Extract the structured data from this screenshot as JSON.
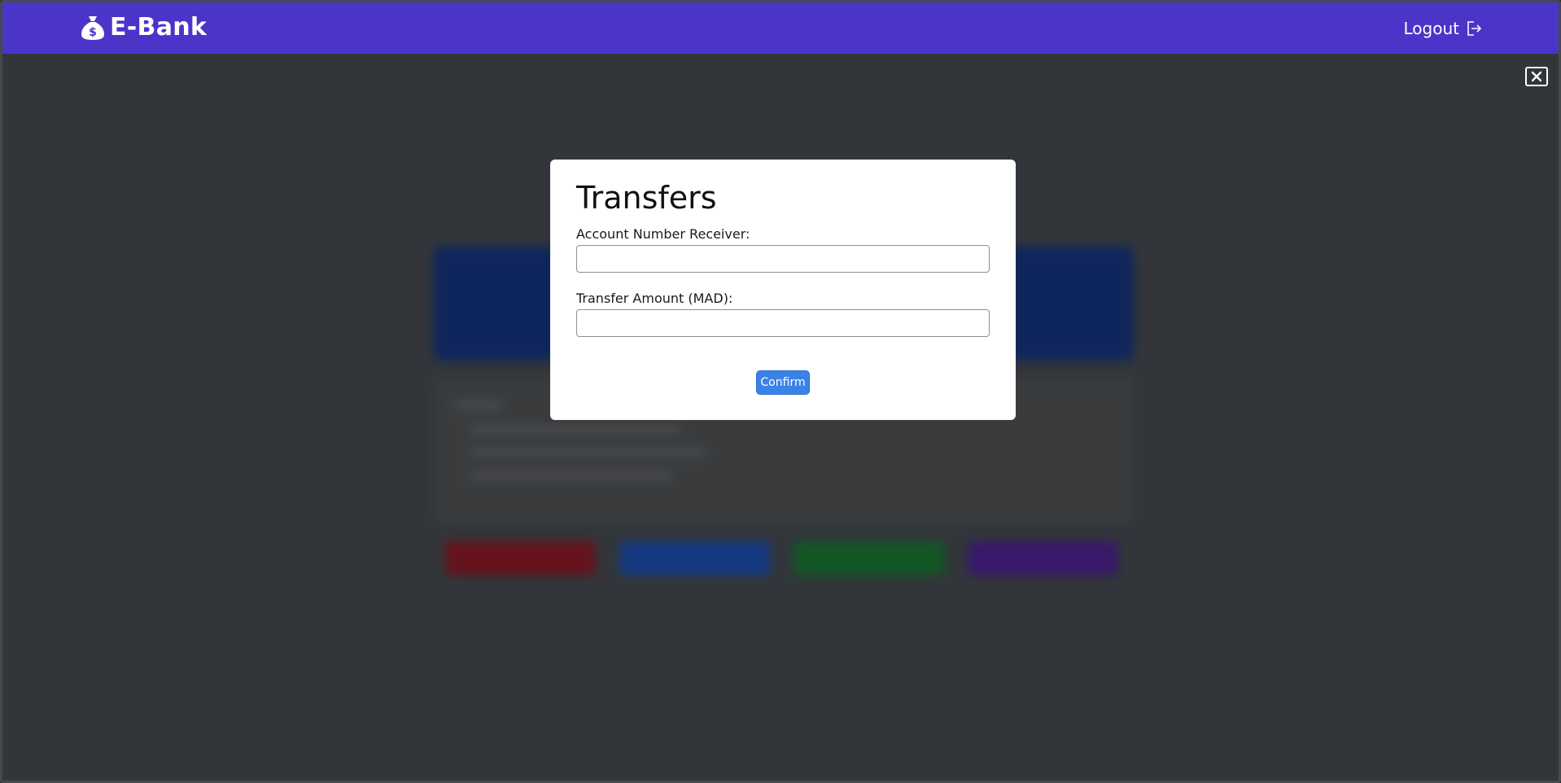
{
  "header": {
    "brand_name": "E-Bank",
    "brand_icon": "money-bag-icon",
    "logout_label": "Logout",
    "logout_icon": "logout-icon",
    "background_color": "#4b35c8"
  },
  "overlay": {
    "close_icon": "close-icon"
  },
  "modal": {
    "title": "Transfers",
    "fields": [
      {
        "label": "Account Number Receiver:",
        "value": "",
        "placeholder": ""
      },
      {
        "label": "Transfer Amount (MAD):",
        "value": "",
        "placeholder": ""
      }
    ],
    "confirm_label": "Confirm",
    "confirm_color": "#3b82e6"
  },
  "background_dashboard": {
    "action_button_colors": [
      "#6b0f1a",
      "#123a8a",
      "#0f5a22",
      "#3a1670"
    ]
  }
}
